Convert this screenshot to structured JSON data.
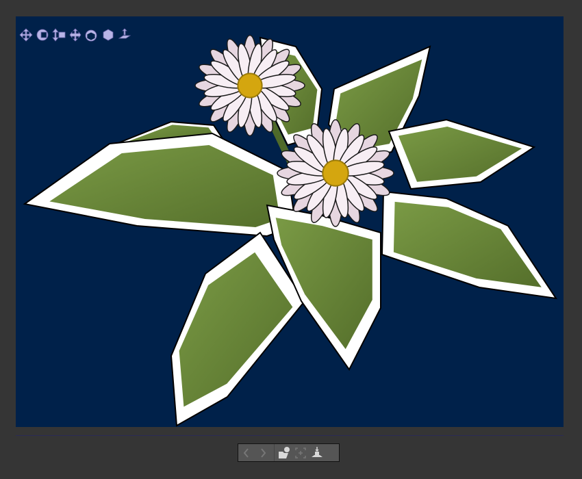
{
  "viewer": {
    "background_color": "#00214a",
    "nav_tools": [
      {
        "icon": "pan-icon"
      },
      {
        "icon": "orbit-icon"
      },
      {
        "icon": "zoom-icon"
      },
      {
        "icon": "move-icon"
      },
      {
        "icon": "rotate-object-icon"
      },
      {
        "icon": "object-icon"
      },
      {
        "icon": "ground-plane-icon"
      }
    ],
    "nav_icon_color": "#b8b4e6"
  },
  "bottom_toolbar": {
    "buttons": [
      {
        "icon": "chevron-left-icon",
        "enabled": false
      },
      {
        "icon": "chevron-right-icon",
        "enabled": false
      },
      {
        "icon": "open-model-icon",
        "enabled": true
      },
      {
        "icon": "frame-fit-icon",
        "enabled": false
      },
      {
        "icon": "place-on-ground-icon",
        "enabled": true
      }
    ]
  },
  "scene": {
    "leaf_color": "#6a8a38",
    "leaf_edge_color": "#ffffff",
    "petal_color": "#f1e6ee",
    "flower_center_color": "#d4a60f"
  }
}
